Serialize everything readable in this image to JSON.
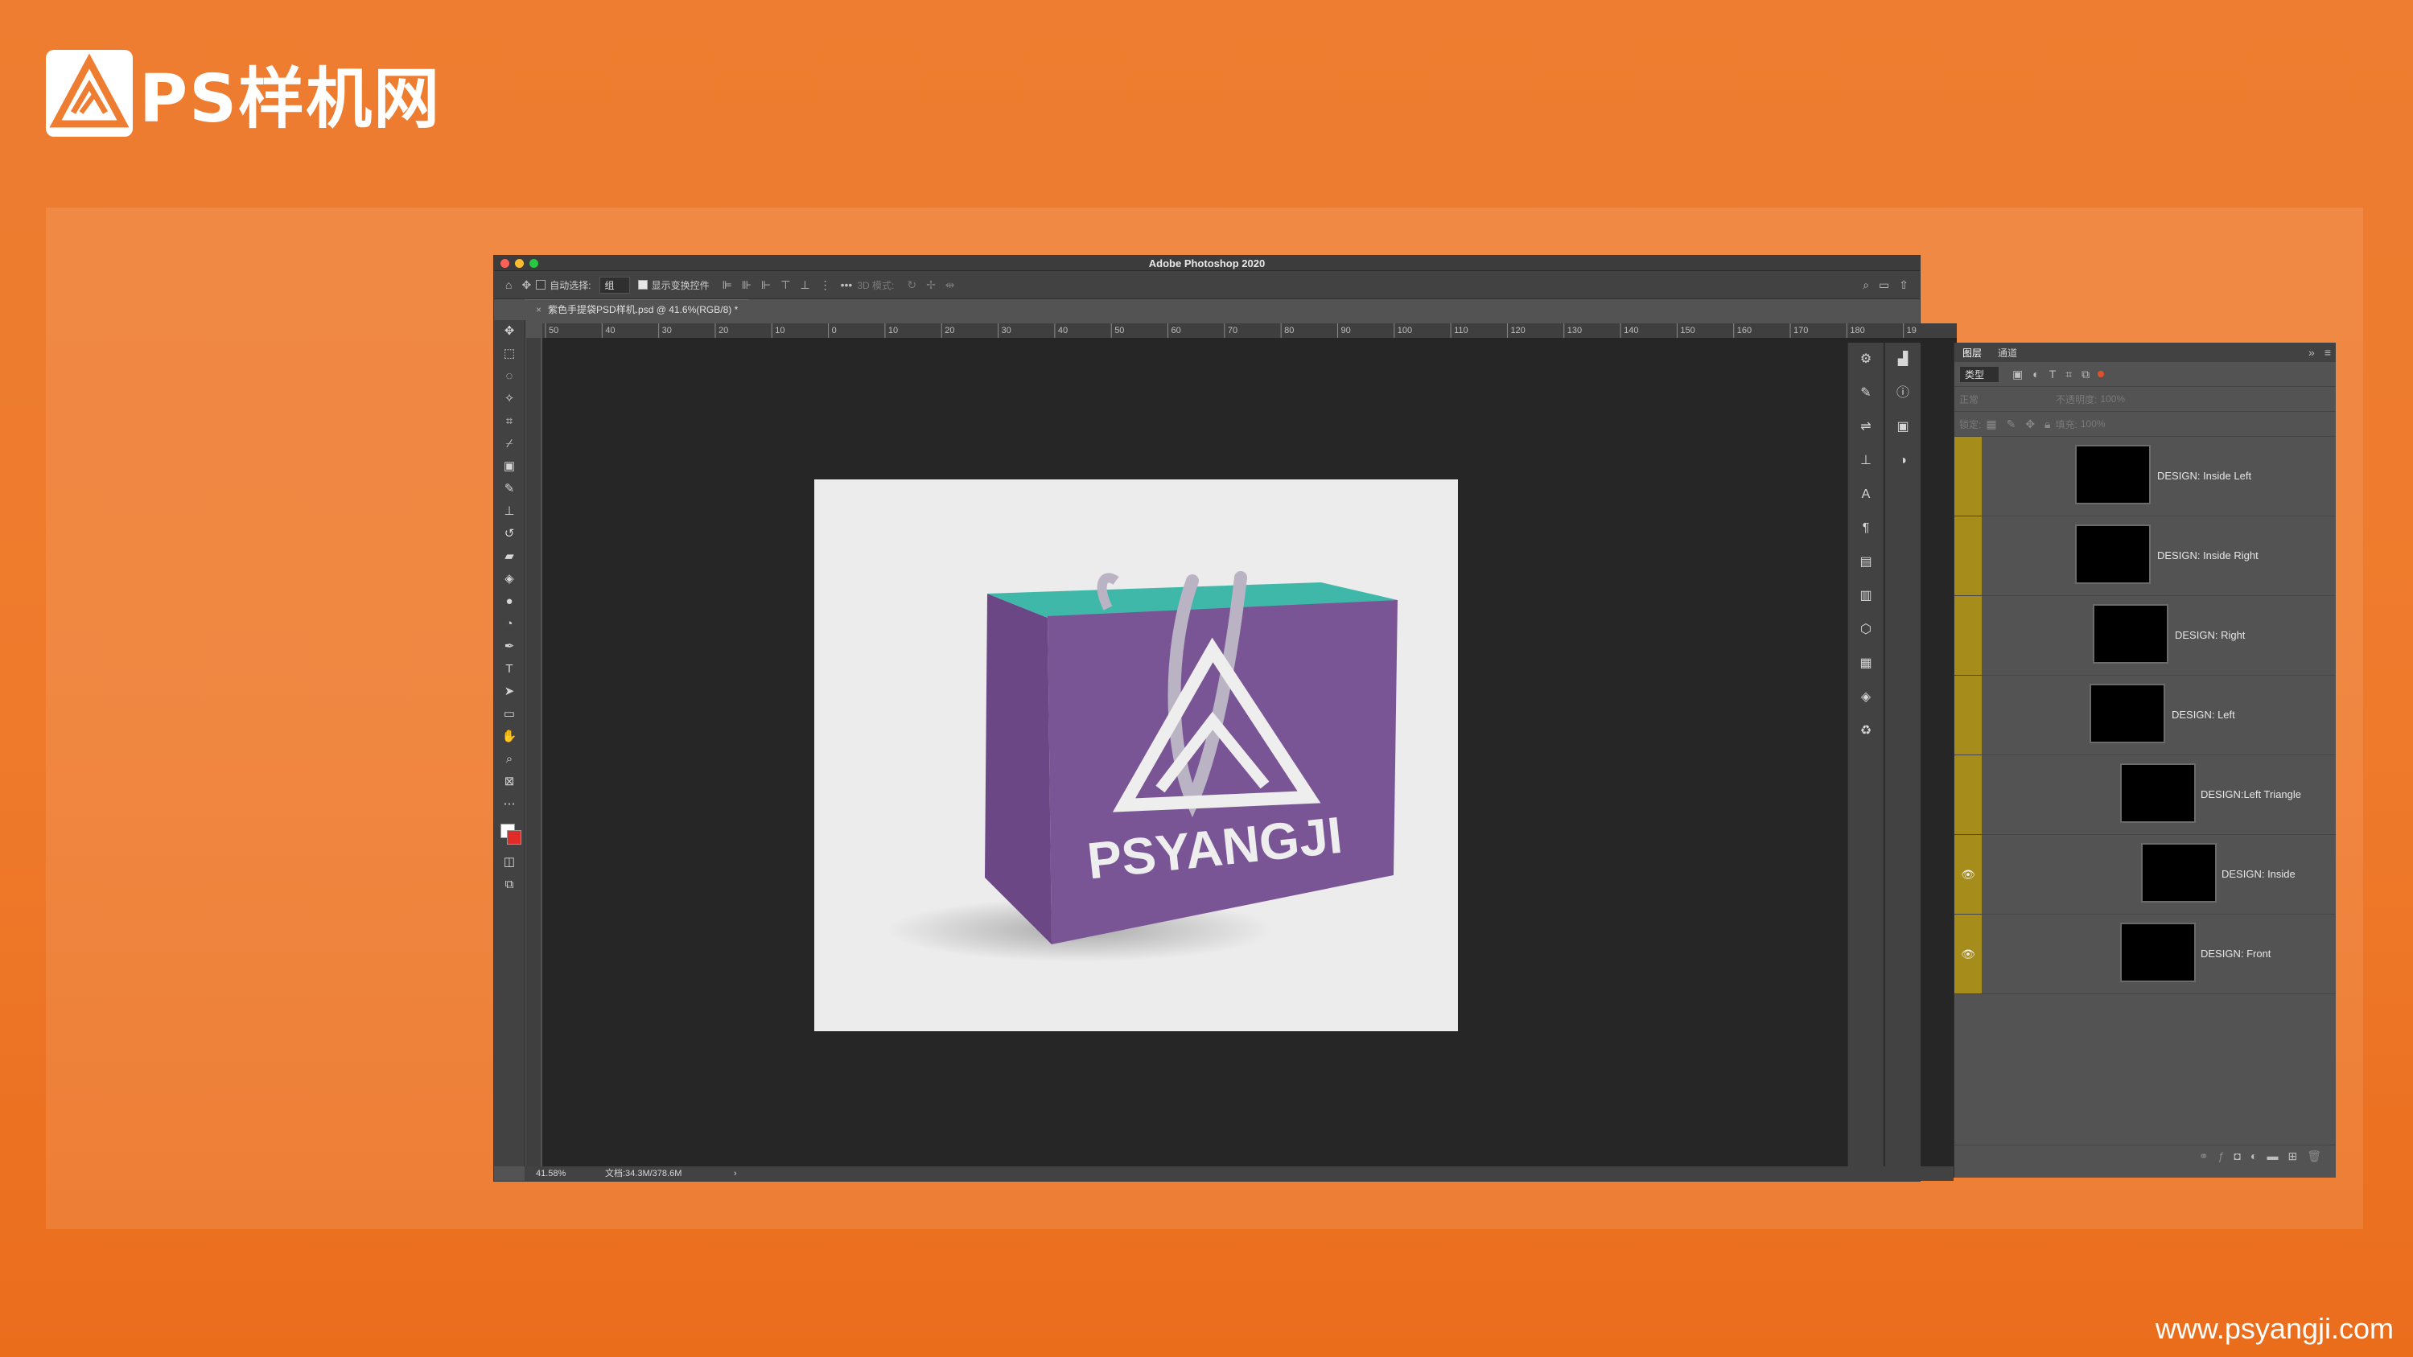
{
  "brand": {
    "name": "PS样机网",
    "url": "www.psyangji.com"
  },
  "app": {
    "window_title": "Adobe Photoshop 2020",
    "document_tab": "紫色手提袋PSD样机.psd @ 41.6%(RGB/8) *",
    "options": {
      "auto_select_label": "自动选择:",
      "auto_select_value": "组",
      "show_transform_label": "显示变换控件",
      "mode_3d_label": "3D 模式:"
    },
    "ruler_labels": [
      "50",
      "40",
      "30",
      "20",
      "10",
      "0",
      "10",
      "20",
      "30",
      "40",
      "50",
      "60",
      "70",
      "80",
      "90",
      "100",
      "110",
      "120",
      "130",
      "140",
      "150",
      "160",
      "170",
      "180",
      "19"
    ],
    "status": {
      "zoom": "41.58%",
      "doc_size": "文档:34.3M/378.6M"
    },
    "layers_panel": {
      "tabs": [
        "图层",
        "通道"
      ],
      "filter_kind": "类型",
      "blend_mode": "正常",
      "opacity_label": "不透明度:",
      "opacity_value": "100%",
      "lock_label": "锁定:",
      "fill_label": "填充:",
      "fill_value": "100%",
      "layers": [
        {
          "name": "DESIGN: Inside Left",
          "visible": false
        },
        {
          "name": "DESIGN: Inside Right",
          "visible": false
        },
        {
          "name": "DESIGN: Right",
          "visible": false
        },
        {
          "name": "DESIGN: Left",
          "visible": false
        },
        {
          "name": "DESIGN:Left Triangle",
          "visible": false
        },
        {
          "name": "DESIGN: Inside",
          "visible": true
        },
        {
          "name": "DESIGN: Front",
          "visible": true
        }
      ]
    }
  },
  "mockup": {
    "bag_text": "PSYANGJI"
  },
  "colors": {
    "bag": "#7a5596",
    "bag_inner": "#3fb7a9",
    "layer_strip": "#a58c1b",
    "accent": "#ef7d31"
  }
}
